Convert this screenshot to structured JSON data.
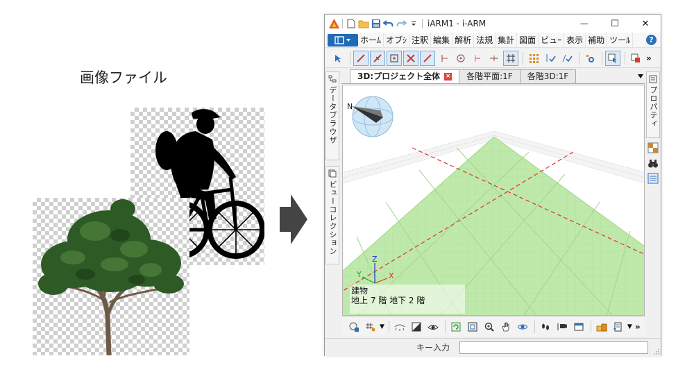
{
  "caption": "画像ファイル",
  "window": {
    "title": "iARM1 - i-ARM",
    "minimize": "—",
    "maximize": "☐",
    "close": "✕"
  },
  "menu": {
    "items": [
      "ホーﾑ",
      "オブｼ",
      "注釈",
      "編集",
      "解析",
      "法規",
      "集計",
      "図面",
      "ビュｰ",
      "表示",
      "補助",
      "ツーﾙ"
    ],
    "help": "?"
  },
  "side_left": {
    "tab1": "データブラウザ",
    "tab2": "ビューコレクション"
  },
  "side_right": {
    "tab1": "プロパティ"
  },
  "tabs": [
    {
      "label": "3D:プロジェクト全体",
      "active": true
    },
    {
      "label": "各階平面:1F",
      "active": false
    },
    {
      "label": "各階3D:1F",
      "active": false
    }
  ],
  "compass": {
    "north": "N"
  },
  "axes": {
    "x": "X",
    "y": "Y",
    "z": "Z"
  },
  "info": {
    "line1": "建物",
    "line2": "地上 7 階  地下 2 階"
  },
  "status": {
    "key_label": "キー入力",
    "key_value": ""
  },
  "colors": {
    "app_menu": "#1f6bb6",
    "grid_green": "#b4e6a0",
    "axis_red": "#e03030",
    "axis_blue": "#2030d0",
    "axis_green": "#20a020"
  }
}
